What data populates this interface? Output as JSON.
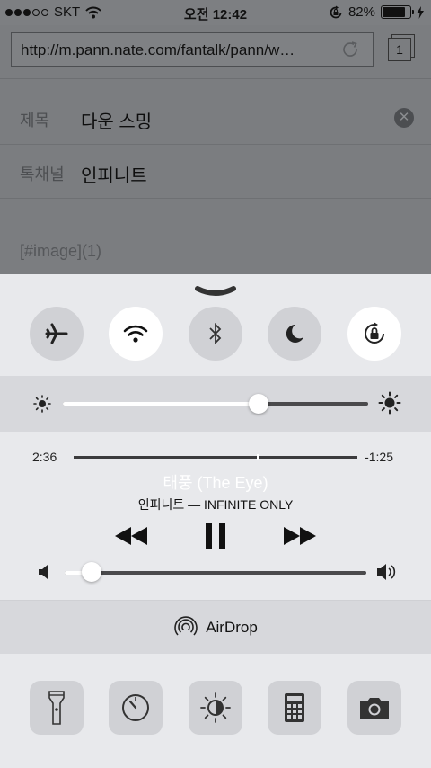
{
  "status_bar": {
    "carrier": "SKT",
    "time": "오전 12:42",
    "battery_percent": "82%",
    "battery_level": 0.82
  },
  "browser": {
    "url": "http://m.pann.nate.com/fantalk/pann/w…",
    "tab_count": "1"
  },
  "form": {
    "title_label": "제목",
    "title_value": "다운 스밍",
    "channel_label": "톡채널",
    "channel_value": "인피니트",
    "body_text": "[#image](1)"
  },
  "control_center": {
    "toggles": [
      {
        "name": "airplane-mode",
        "on": false
      },
      {
        "name": "wifi",
        "on": true
      },
      {
        "name": "bluetooth",
        "on": false
      },
      {
        "name": "do-not-disturb",
        "on": false
      },
      {
        "name": "rotation-lock",
        "on": true
      }
    ],
    "brightness_level": 0.64,
    "now_playing": {
      "elapsed": "2:36",
      "remaining": "-1:25",
      "progress": 0.65,
      "title": "태풍 (The Eye)",
      "artist_album": "인피니트 — INFINITE ONLY"
    },
    "volume_level": 0.09,
    "airdrop_label": "AirDrop",
    "tools": [
      "flashlight",
      "timer",
      "night-shift",
      "calculator",
      "camera"
    ]
  }
}
